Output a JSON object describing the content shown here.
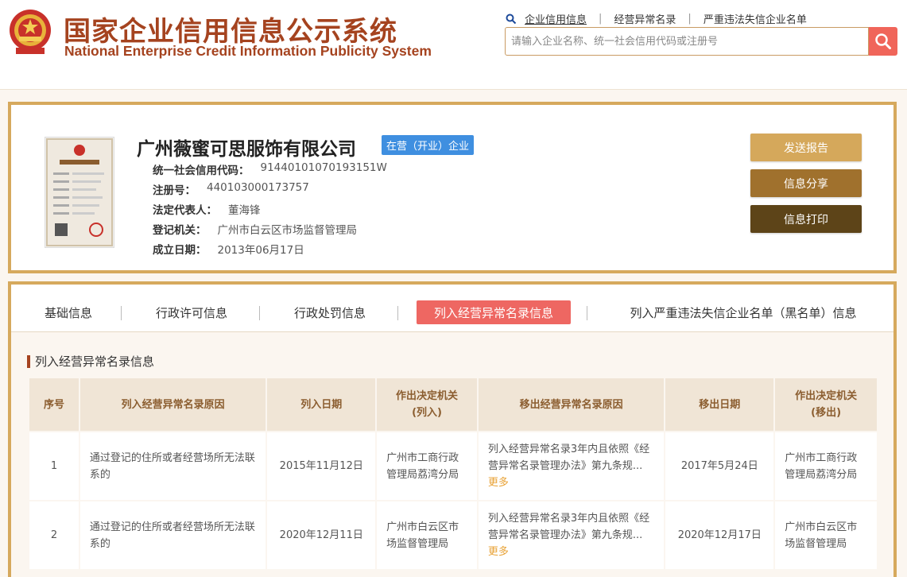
{
  "header": {
    "title_cn": "国家企业信用信息公示系统",
    "title_en": "National Enterprise Credit Information Publicity System",
    "nav": [
      "企业信用信息",
      "经营异常名录",
      "严重违法失信企业名单"
    ],
    "search_placeholder": "请输入企业名称、统一社会信用代码或注册号"
  },
  "company": {
    "name": "广州薇蜜可思服饰有限公司",
    "status": "在营（开业）企业",
    "fields": [
      {
        "label": "统一社会信用代码：",
        "value": "91440101070193151W"
      },
      {
        "label": "注册号：",
        "value": "440103000173757"
      },
      {
        "label": "法定代表人：",
        "value": "董海锋"
      },
      {
        "label": "登记机关：",
        "value": "广州市白云区市场监督管理局"
      },
      {
        "label": "成立日期：",
        "value": "2013年06月17日"
      }
    ],
    "actions": [
      "发送报告",
      "信息分享",
      "信息打印"
    ]
  },
  "tabs": [
    "基础信息",
    "行政许可信息",
    "行政处罚信息",
    "列入经营异常名录信息",
    "列入严重违法失信企业名单（黑名单）信息"
  ],
  "section": {
    "title": "列入经营异常名录信息",
    "headers": [
      "序号",
      "列入经营异常名录原因",
      "列入日期",
      "作出决定机关\n(列入)",
      "移出经营异常名录原因",
      "移出日期",
      "作出决定机关\n(移出)"
    ],
    "rows": [
      {
        "no": "1",
        "reason_in": "通过登记的住所或者经营场所无法联系的",
        "date_in": "2015年11月12日",
        "org_in": "广州市工商行政管理局荔湾分局",
        "reason_out": "列入经营异常名录3年内且依照《经营异常名录管理办法》第九条规...",
        "more": "更多",
        "date_out": "2017年5月24日",
        "org_out": "广州市工商行政管理局荔湾分局"
      },
      {
        "no": "2",
        "reason_in": "通过登记的住所或者经营场所无法联系的",
        "date_in": "2020年12月11日",
        "org_in": "广州市白云区市场监督管理局",
        "reason_out": "列入经营异常名录3年内且依照《经营异常名录管理办法》第九条规...",
        "more": "更多",
        "date_out": "2020年12月17日",
        "org_out": "广州市白云区市场监督管理局"
      }
    ]
  },
  "colors": {
    "brand": "#a5431f",
    "card_border": "#d6a95d",
    "active_tab": "#ee6762",
    "btn_report": "#d5a85b",
    "btn_share": "#a0712d",
    "btn_print": "#5d4418",
    "status_badge": "#3f8fe0"
  }
}
